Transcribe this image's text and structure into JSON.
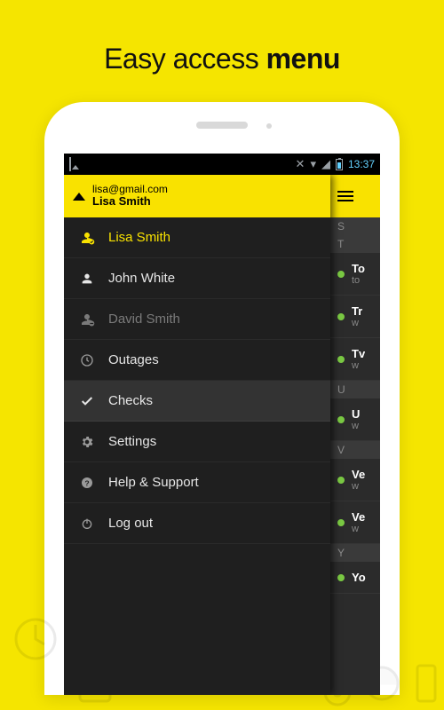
{
  "headline": {
    "pre": "Easy access ",
    "bold": "menu"
  },
  "statusbar": {
    "time": "13:37"
  },
  "account": {
    "email": "lisa@gmail.com",
    "name": "Lisa Smith"
  },
  "menu": {
    "users": [
      {
        "label": "Lisa Smith",
        "style": "active"
      },
      {
        "label": "John White",
        "style": "normal"
      },
      {
        "label": "David Smith",
        "style": "dim"
      }
    ],
    "items": [
      {
        "label": "Outages",
        "icon": "clock"
      },
      {
        "label": "Checks",
        "icon": "check",
        "selected": true
      },
      {
        "label": "Settings",
        "icon": "gear"
      },
      {
        "label": "Help & Support",
        "icon": "help"
      },
      {
        "label": "Log out",
        "icon": "power"
      }
    ]
  },
  "list": {
    "sections": [
      {
        "letter": "S"
      },
      {
        "letter": "T",
        "rows": [
          {
            "title": "To",
            "sub": "to"
          },
          {
            "title": "Tr",
            "sub": "w"
          },
          {
            "title": "Tv",
            "sub": "w"
          }
        ]
      },
      {
        "letter": "U",
        "rows": [
          {
            "title": "U",
            "sub": "w"
          }
        ]
      },
      {
        "letter": "V",
        "rows": [
          {
            "title": "Ve",
            "sub": "w"
          },
          {
            "title": "Ve",
            "sub": "w"
          }
        ]
      },
      {
        "letter": "Y",
        "rows": [
          {
            "title": "Yo",
            "sub": ""
          }
        ]
      }
    ]
  }
}
